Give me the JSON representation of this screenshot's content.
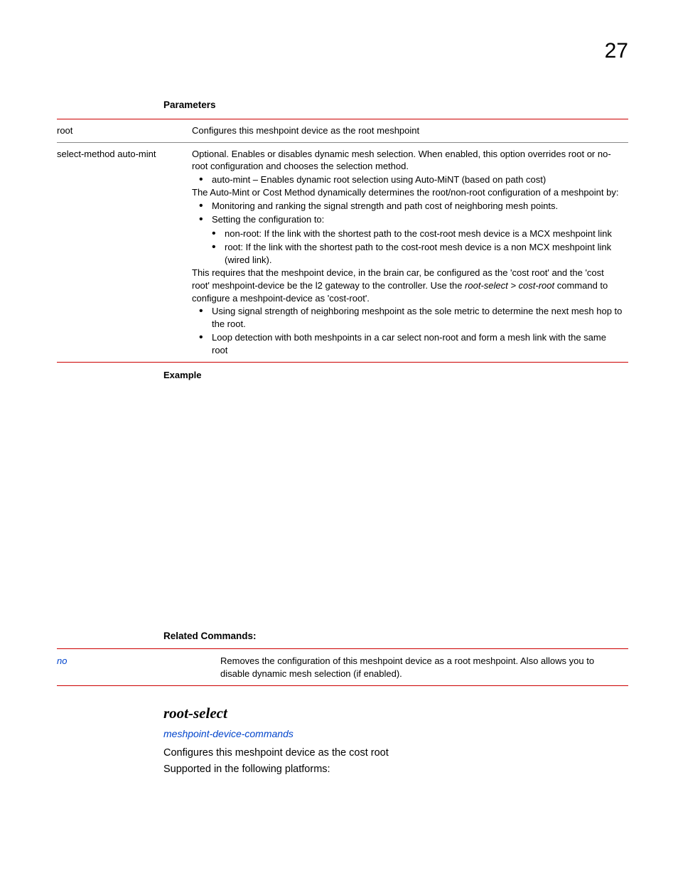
{
  "pageNumber": "27",
  "paramHeading": "Parameters",
  "paramTable": {
    "row1": {
      "name": "root",
      "desc": "Configures this meshpoint device as the root meshpoint"
    },
    "row2": {
      "name": "select-method auto-mint",
      "p1": "Optional. Enables or disables dynamic mesh selection. When enabled, this option overrides root or no-root configuration and chooses the selection method.",
      "b1": "auto-mint – Enables dynamic root selection using Auto-MiNT (based on path cost)",
      "p2": "The Auto-Mint or Cost Method dynamically determines the root/non-root configuration of a meshpoint by:",
      "b2": "Monitoring and ranking the signal strength and path cost of neighboring mesh points.",
      "b3": "Setting the configuration to:",
      "sb1": "non-root: If the link with the shortest path to the cost-root mesh device is a MCX meshpoint link",
      "sb2": "root: If the link with the shortest path to the cost-root mesh device is a non MCX meshpoint link (wired link).",
      "p3a": "This requires that the meshpoint device, in the brain car, be configured as the 'cost root' and the 'cost root' meshpoint-device be the l2 gateway to the controller. Use the ",
      "p3i": "root-select > cost-root",
      "p3b": " command to configure a meshpoint-device as 'cost-root'.",
      "b4": "Using signal strength of neighboring meshpoint as the sole metric to determine the next mesh hop to the root.",
      "b5": "Loop detection with both meshpoints in a car select non-root and form a mesh link with the same root"
    }
  },
  "exampleHeading": "Example",
  "relatedHeading": "Related Commands:",
  "relatedTable": {
    "name": "no",
    "desc": "Removes the configuration of this meshpoint device as a root meshpoint. Also allows you to disable dynamic mesh selection (if enabled)."
  },
  "commandTitle": "root-select",
  "commandLink": "meshpoint-device-commands",
  "body1": "Configures this meshpoint device as the cost root",
  "body2": "Supported in the following platforms:"
}
